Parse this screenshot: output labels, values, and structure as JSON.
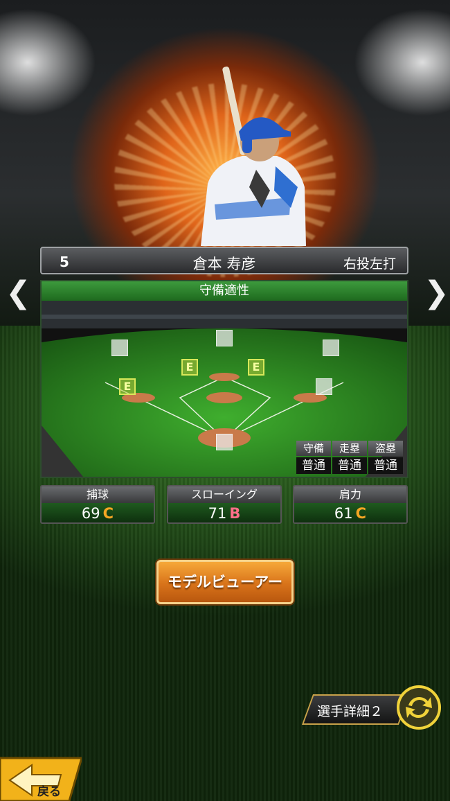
{
  "player": {
    "number": "5",
    "name": "倉本 寿彦",
    "handedness": "右投左打"
  },
  "defense_panel": {
    "title": "守備適性",
    "positions": [
      {
        "id": "lf",
        "grade": ""
      },
      {
        "id": "cf",
        "grade": ""
      },
      {
        "id": "rf",
        "grade": ""
      },
      {
        "id": "ss",
        "grade": "E"
      },
      {
        "id": "2b",
        "grade": "E"
      },
      {
        "id": "3b",
        "grade": "E"
      },
      {
        "id": "1b",
        "grade": ""
      },
      {
        "id": "c",
        "grade": ""
      }
    ],
    "skills": {
      "headers": [
        "守備",
        "走塁",
        "盗塁"
      ],
      "values": [
        "普通",
        "普通",
        "普通"
      ]
    }
  },
  "stats": [
    {
      "label": "捕球",
      "value": "69",
      "grade": "C",
      "grade_color": "#f5a623"
    },
    {
      "label": "スローイング",
      "value": "71",
      "grade": "B",
      "grade_color": "#ff6f8a"
    },
    {
      "label": "肩力",
      "value": "61",
      "grade": "C",
      "grade_color": "#f5a623"
    }
  ],
  "buttons": {
    "model_viewer": "モデルビューアー",
    "player_detail": "選手詳細２",
    "back": "戻る"
  },
  "nav": {
    "prev": "❮",
    "next": "❯"
  },
  "icons": {
    "cycle": "cycle-icon",
    "back": "back-arrow-icon"
  }
}
